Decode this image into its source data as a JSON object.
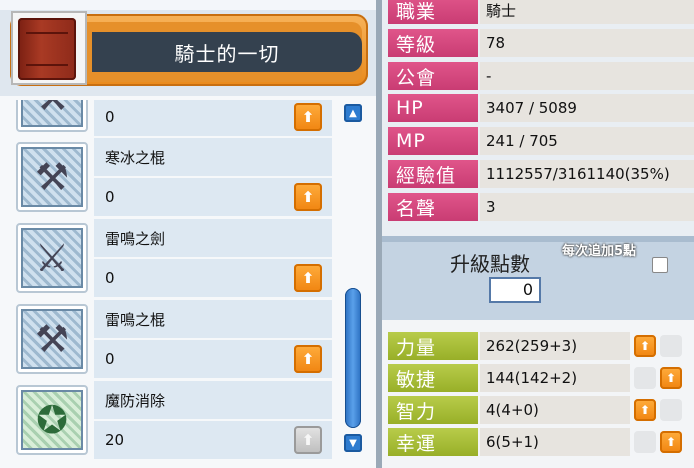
{
  "book": {
    "title": "騎士的一切"
  },
  "skills": [
    {
      "name": "",
      "level": "0",
      "icon": "mace-icon",
      "can_add": true
    },
    {
      "name": "寒冰之棍",
      "level": "0",
      "icon": "mace-icon",
      "can_add": true
    },
    {
      "name": "雷鳴之劍",
      "level": "0",
      "icon": "sword-icon",
      "can_add": true
    },
    {
      "name": "雷鳴之棍",
      "level": "0",
      "icon": "mace-icon",
      "can_add": true
    },
    {
      "name": "魔防消除",
      "level": "20",
      "icon": "magic-crash-icon",
      "can_add": false
    }
  ],
  "info": [
    {
      "label": "職業",
      "value": "騎士"
    },
    {
      "label": "等級",
      "value": "78"
    },
    {
      "label": "公會",
      "value": "-"
    },
    {
      "label": "HP",
      "value": "3407 / 5089"
    },
    {
      "label": "MP",
      "value": "241 / 705"
    },
    {
      "label": "經驗值",
      "value": "1112557/3161140(35%)"
    },
    {
      "label": "名聲",
      "value": "3"
    }
  ],
  "ap": {
    "label": "升級點數",
    "value": "0",
    "auto_label": "每次追加5點",
    "auto_checked": false
  },
  "attributes": [
    {
      "label": "力量",
      "value": "262(259+3)",
      "left_on": true,
      "right_on": false
    },
    {
      "label": "敏捷",
      "value": "144(142+2)",
      "left_on": false,
      "right_on": true
    },
    {
      "label": "智力",
      "value": "4(4+0)",
      "left_on": true,
      "right_on": false
    },
    {
      "label": "幸運",
      "value": "6(5+1)",
      "left_on": false,
      "right_on": true
    }
  ],
  "colors": {
    "info_label": "#d24a7f",
    "attr_label": "#a8bd36",
    "accent_orange": "#f08410",
    "scroll_blue": "#2e7cd0"
  }
}
